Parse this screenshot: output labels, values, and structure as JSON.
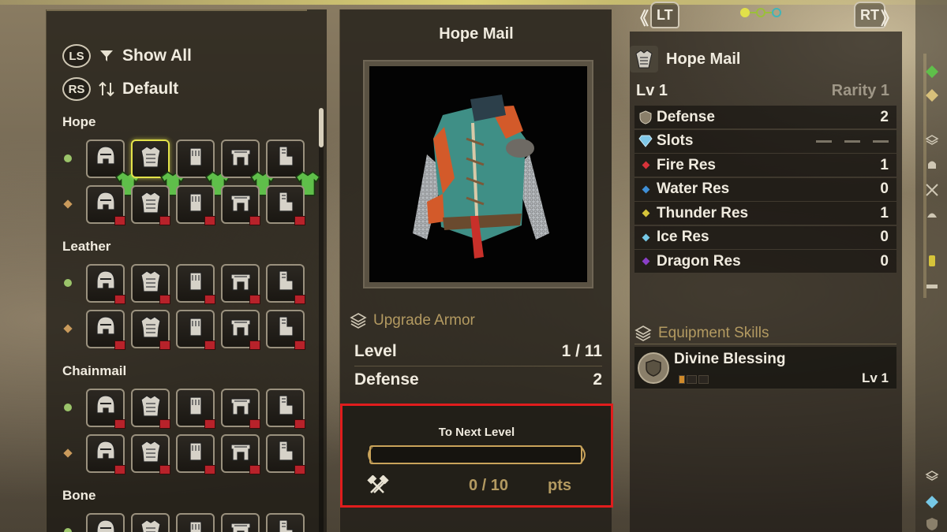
{
  "list": {
    "filter_btn_badge": "LS",
    "filter_label": "Show All",
    "sort_btn_badge": "RS",
    "sort_label": "Default",
    "categories": [
      "Hope",
      "Leather",
      "Chainmail",
      "Bone"
    ],
    "slot_types": [
      "helm",
      "chest",
      "arms",
      "waist",
      "legs"
    ]
  },
  "details": {
    "title": "Hope Mail",
    "upgrade_label": "Upgrade Armor",
    "level_label": "Level",
    "level_value": "1 / 11",
    "defense_label": "Defense",
    "defense_value": "2",
    "next_level": {
      "title": "To Next Level",
      "current": 0,
      "required": 10,
      "value_text": "0 / 10",
      "unit": "pts"
    }
  },
  "nav": {
    "left_button": "LT",
    "right_button": "RT",
    "left_arrow": "《",
    "right_arrow": "》",
    "page_count": 3,
    "active_page": 1
  },
  "armor": {
    "name": "Hope Mail",
    "level": "Lv 1",
    "rarity": "Rarity 1",
    "stats": [
      {
        "label": "Defense",
        "value": "2",
        "color": "#c9a35a"
      },
      {
        "label": "Slots",
        "value": "",
        "color": "#7fc7e8"
      },
      {
        "label": "Fire Res",
        "value": "1",
        "color": "#d8333a"
      },
      {
        "label": "Water Res",
        "value": "0",
        "color": "#3f8fd6"
      },
      {
        "label": "Thunder Res",
        "value": "1",
        "color": "#d6c43a"
      },
      {
        "label": "Ice Res",
        "value": "0",
        "color": "#76c8e6"
      },
      {
        "label": "Dragon Res",
        "value": "0",
        "color": "#8a3fc7"
      }
    ],
    "skills_header": "Equipment Skills",
    "skill": {
      "name": "Divine Blessing",
      "level": "Lv 1",
      "level_num": 1,
      "max_level": 3
    }
  },
  "colors": {
    "highlight": "#e01d1d",
    "selected": "#e4e34a",
    "gold": "#c9a35a",
    "obtained_green": "#5fbf4a",
    "missing_red": "#b8222a"
  }
}
